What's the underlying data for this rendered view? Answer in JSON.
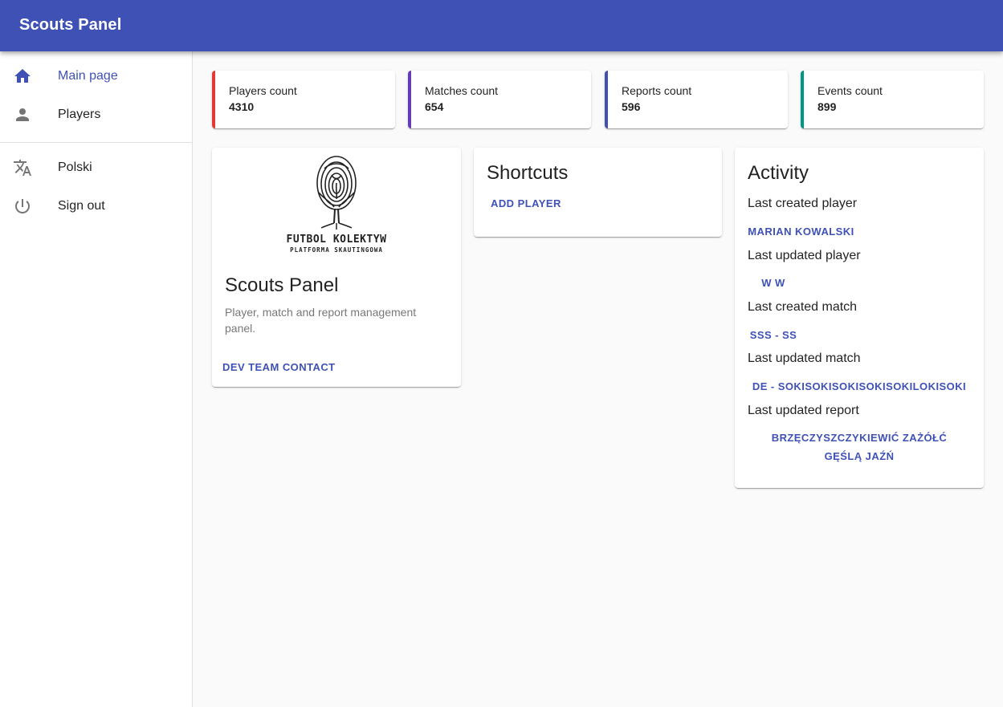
{
  "app": {
    "title": "Scouts Panel"
  },
  "sidebar": {
    "items": [
      {
        "label": "Main page",
        "icon": "home-icon",
        "active": true
      },
      {
        "label": "Players",
        "icon": "person-icon",
        "active": false
      },
      {
        "label": "Polski",
        "icon": "translate-icon",
        "active": false
      },
      {
        "label": "Sign out",
        "icon": "power-icon",
        "active": false
      }
    ]
  },
  "stats": [
    {
      "label": "Players count",
      "value": "4310",
      "color": "#e53935"
    },
    {
      "label": "Matches count",
      "value": "654",
      "color": "#673ab7"
    },
    {
      "label": "Reports count",
      "value": "596",
      "color": "#3f51b5"
    },
    {
      "label": "Events count",
      "value": "899",
      "color": "#009688"
    }
  ],
  "about": {
    "logo_text": "FUTBOL KOLEKTYW",
    "logo_subtext": "PLATFORMA SKAUTINGOWA",
    "title": "Scouts Panel",
    "description": "Player, match and report management panel.",
    "contact_label": "DEV TEAM CONTACT"
  },
  "shortcuts": {
    "title": "Shortcuts",
    "add_player_label": "ADD PLAYER"
  },
  "activity": {
    "title": "Activity",
    "items": [
      {
        "label": "Last created player",
        "value": "MARIAN KOWALSKI"
      },
      {
        "label": "Last updated player",
        "value": "W W"
      },
      {
        "label": "Last created match",
        "value": "SSS - SS"
      },
      {
        "label": "Last updated match",
        "value": "DE - SOKISOKISOKISOKISOKILOKISOKI"
      },
      {
        "label": "Last updated report",
        "value": "BRZĘCZYSZCZYKIEWIĆ ZAŻÓŁĆ GĘŚLĄ JAŹŃ"
      }
    ]
  }
}
